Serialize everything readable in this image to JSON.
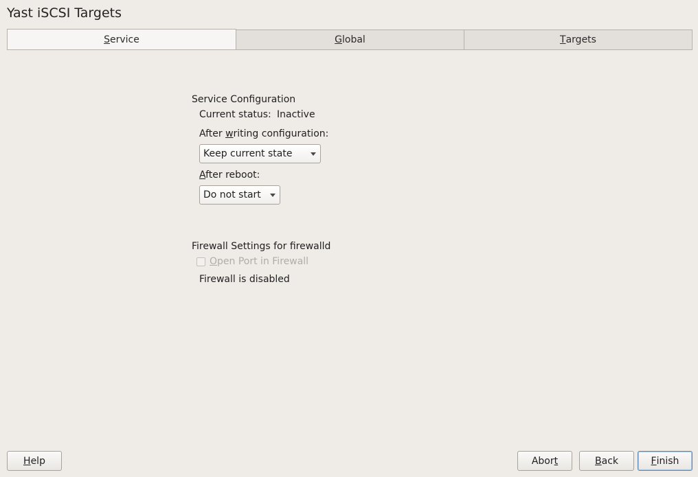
{
  "window": {
    "title": "Yast iSCSI Targets"
  },
  "tabs": [
    {
      "pre": "",
      "mnemonic": "S",
      "post": "ervice",
      "active": true
    },
    {
      "pre": "",
      "mnemonic": "G",
      "post": "lobal",
      "active": false
    },
    {
      "pre": "",
      "mnemonic": "T",
      "post": "argets",
      "active": false
    }
  ],
  "service": {
    "section_title": "Service Configuration",
    "status_label": "Current status:",
    "status_value": "Inactive",
    "after_writing": {
      "pre": "After ",
      "mnemonic": "w",
      "post": "riting configuration:"
    },
    "after_writing_value": "Keep current state",
    "after_reboot": {
      "pre": "",
      "mnemonic": "A",
      "post": "fter reboot:"
    },
    "after_reboot_value": "Do not start"
  },
  "firewall": {
    "section_title": "Firewall Settings for firewalld",
    "open_port": {
      "pre": "",
      "mnemonic": "O",
      "post": "pen Port in Firewall"
    },
    "open_port_checked": false,
    "status": "Firewall is disabled"
  },
  "buttons": {
    "help": {
      "pre": "",
      "mnemonic": "H",
      "post": "elp"
    },
    "abort": {
      "pre": "Abor",
      "mnemonic": "t",
      "post": ""
    },
    "back": {
      "pre": "",
      "mnemonic": "B",
      "post": "ack"
    },
    "finish": {
      "pre": "",
      "mnemonic": "F",
      "post": "inish"
    }
  },
  "icons": {
    "combo_arrow": "chevron-down-icon"
  }
}
